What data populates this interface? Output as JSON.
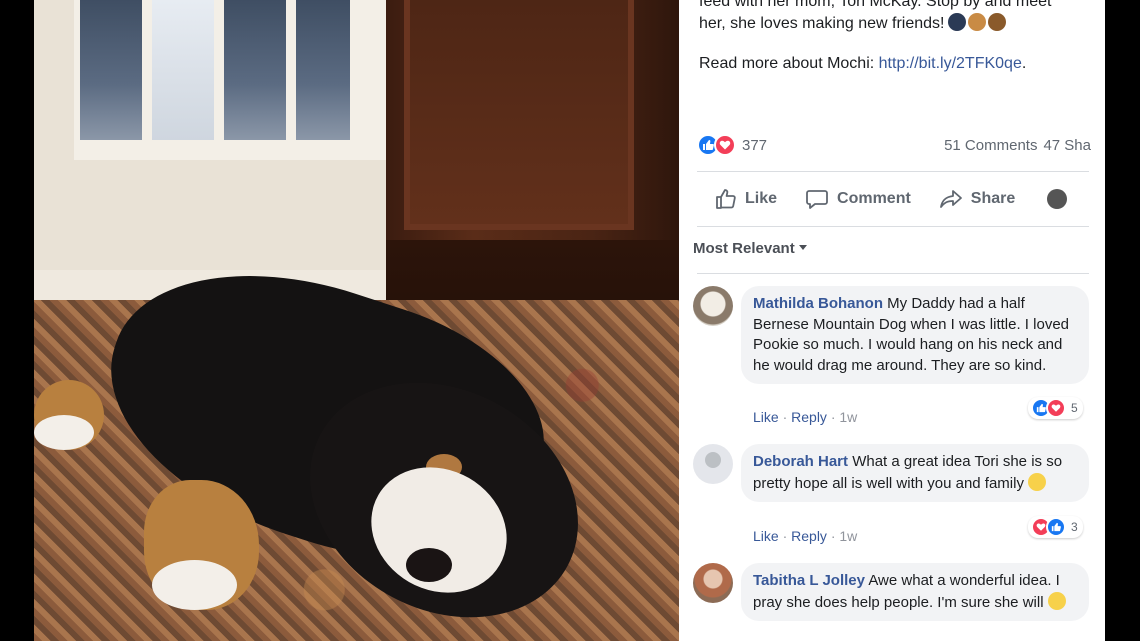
{
  "post": {
    "text_line1": "feed with her mom, Tori McKay. Stop by and meet",
    "text_line2": "her, she loves making new friends!",
    "read_more_label": "Read more about Mochi:",
    "read_more_link": "http://bit.ly/2TFK0qe",
    "read_more_suffix": ".",
    "reaction_count": "377",
    "comments_count": "51 Comments",
    "shares_count": "47 Sha"
  },
  "actions": {
    "like": "Like",
    "comment": "Comment",
    "share": "Share"
  },
  "sort_label": "Most Relevant",
  "comments": [
    {
      "author": "Mathilda Bohanon",
      "text": "My Daddy had a half Bernese Mountain Dog when I was little. I loved Pookie so much. I would hang on his neck and he would drag me around. They are so kind.",
      "like": "Like",
      "reply": "Reply",
      "time": "1w",
      "reaction_count": "5"
    },
    {
      "author": "Deborah Hart",
      "text": "What a great idea Tori she is so pretty hope all is well with you and family",
      "like": "Like",
      "reply": "Reply",
      "time": "1w",
      "reaction_count": "3"
    },
    {
      "author": "Tabitha L Jolley",
      "text": "Awe what a wonderful idea. I pray she does help people. I'm sure she will"
    }
  ],
  "colors": {
    "fb_blue": "#385898",
    "like_blue": "#1877f2",
    "love_red": "#f33e58",
    "gray_text": "#606770"
  }
}
